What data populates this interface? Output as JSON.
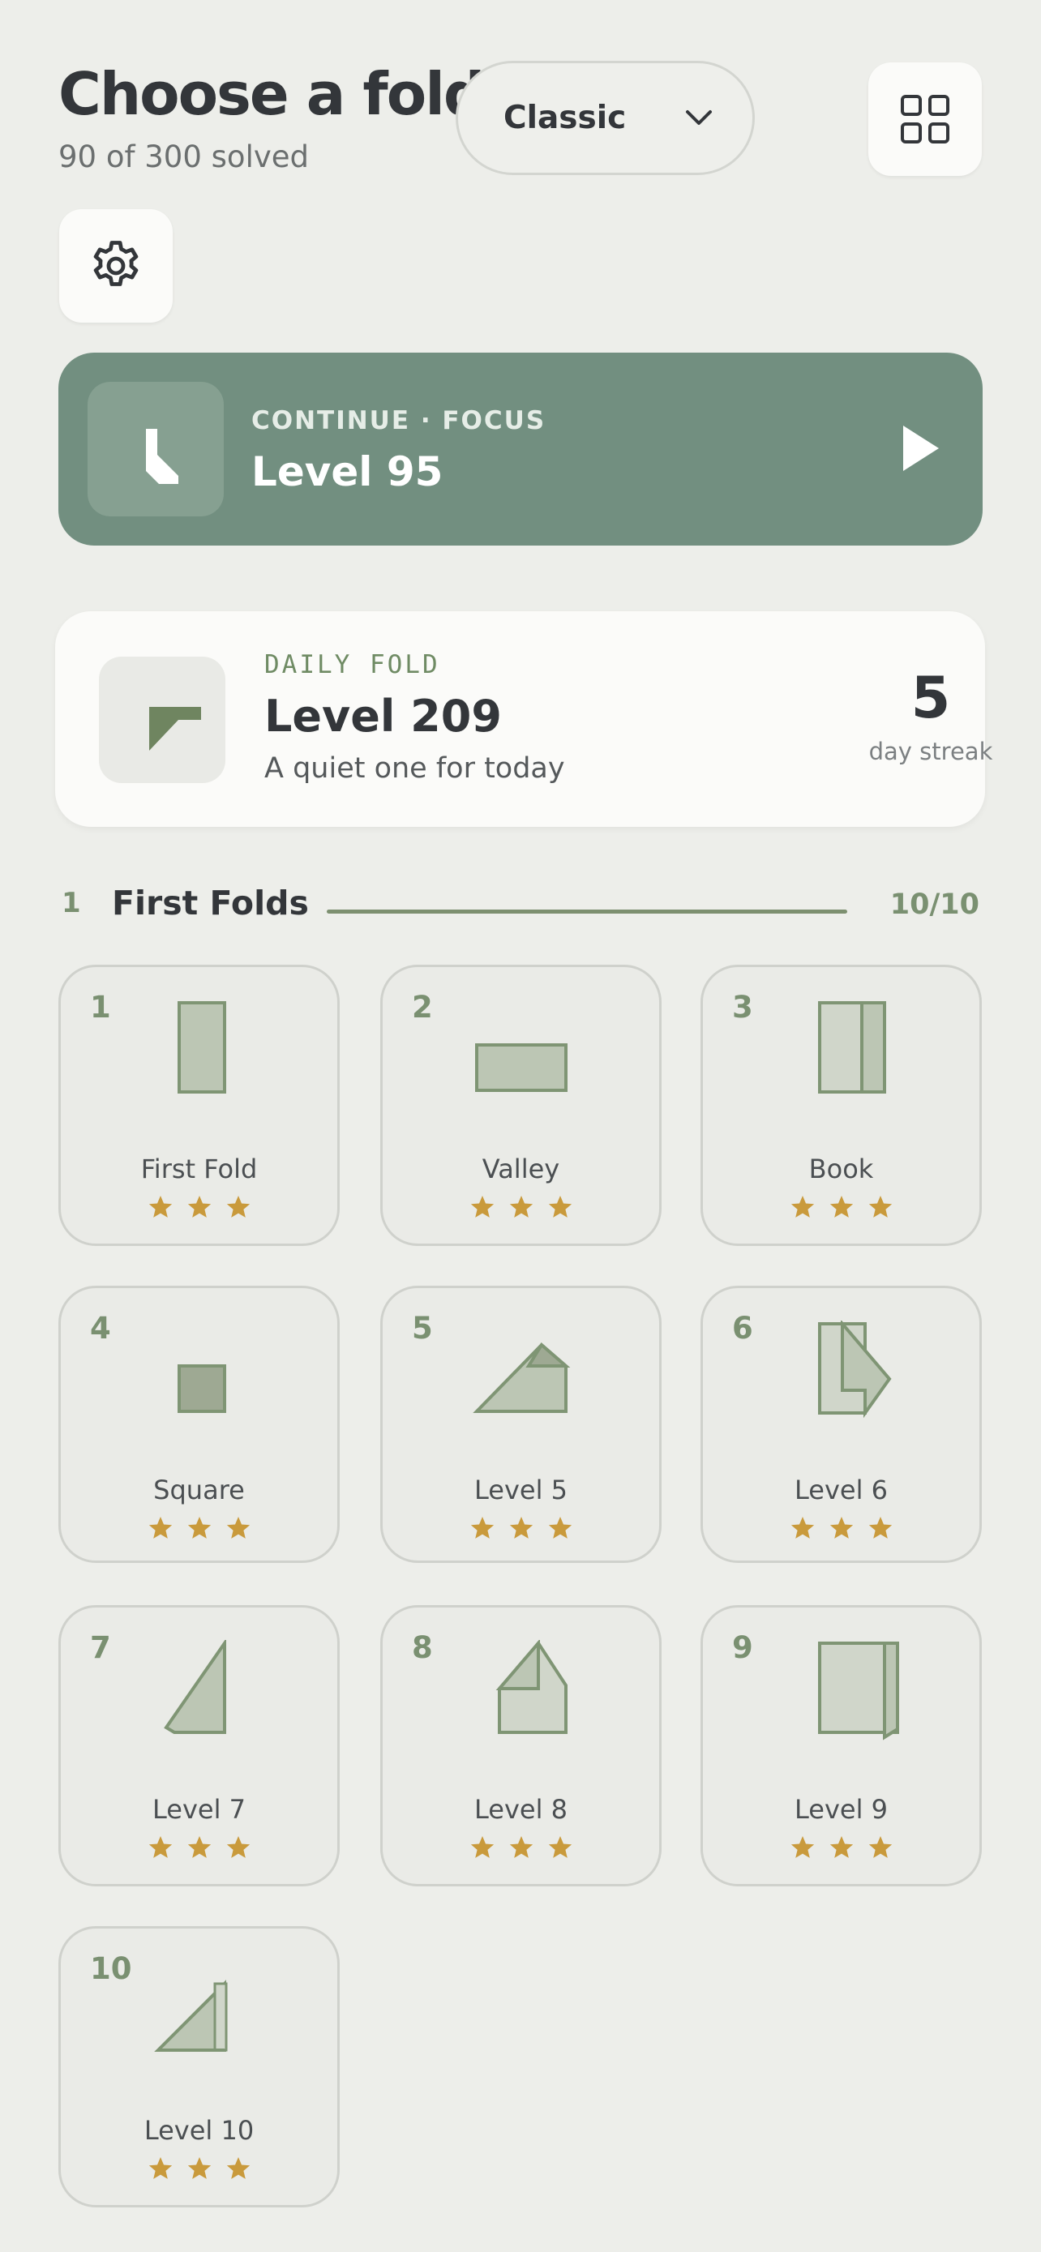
{
  "header": {
    "title": "Choose a fold",
    "progress": "90 of 300 solved",
    "mode": "Classic",
    "grid_button_icon": "grid-icon",
    "settings_button_icon": "gear-icon"
  },
  "continue_card": {
    "kicker": "CONTINUE · FOCUS",
    "title": "Level 95",
    "play_icon": "play-icon"
  },
  "daily": {
    "kicker": "DAILY FOLD",
    "title": "Level 209",
    "subtitle": "A quiet one for today",
    "streak_count": "5",
    "streak_label": "day streak"
  },
  "section": {
    "number": "1",
    "title": "First Folds",
    "count": "10/10",
    "completion": 1.0
  },
  "levels": [
    {
      "number": "1",
      "name": "First Fold",
      "stars": 3
    },
    {
      "number": "2",
      "name": "Valley",
      "stars": 3
    },
    {
      "number": "3",
      "name": "Book",
      "stars": 3
    },
    {
      "number": "4",
      "name": "Square",
      "stars": 3
    },
    {
      "number": "5",
      "name": "Level 5",
      "stars": 3
    },
    {
      "number": "6",
      "name": "Level 6",
      "stars": 3
    },
    {
      "number": "7",
      "name": "Level 7",
      "stars": 3
    },
    {
      "number": "8",
      "name": "Level 8",
      "stars": 3
    },
    {
      "number": "9",
      "name": "Level 9",
      "stars": 3
    },
    {
      "number": "10",
      "name": "Level 10",
      "stars": 3
    }
  ],
  "colors": {
    "accent": "#728f80",
    "star": "#c99a3c",
    "paper": "#bcc6b4",
    "paper_stroke": "#7f9574"
  }
}
